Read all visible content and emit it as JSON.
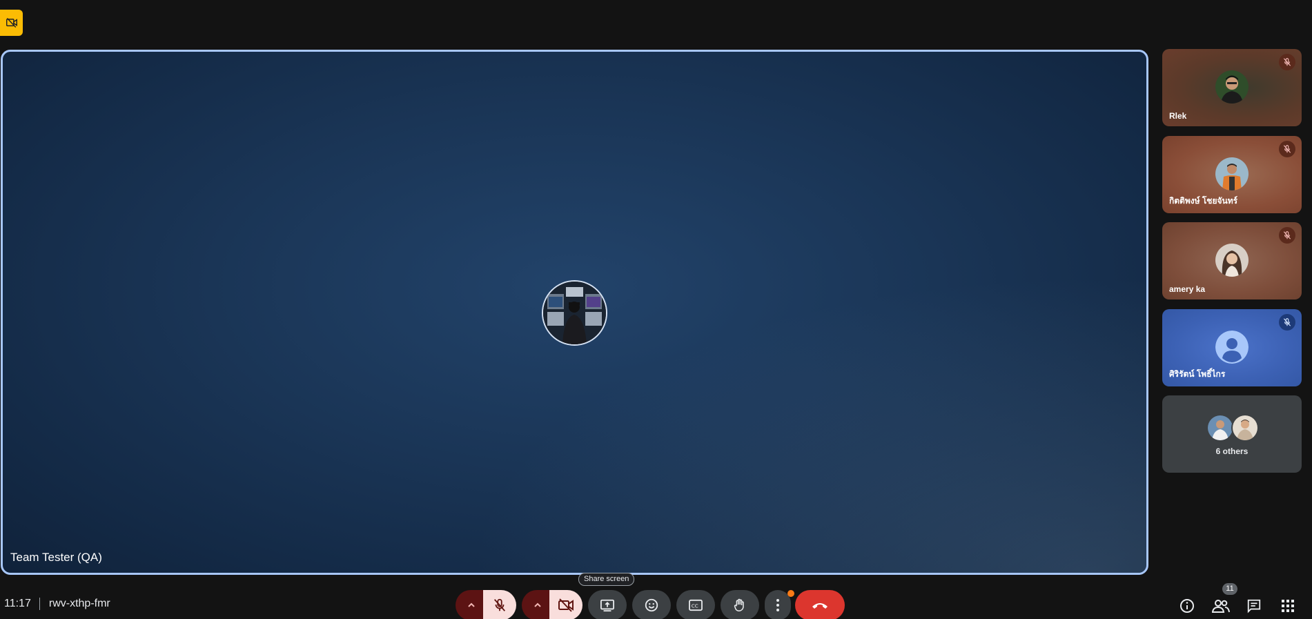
{
  "meeting": {
    "time": "11:17",
    "code": "rwv-xthp-fmr"
  },
  "main_tile": {
    "name": "Team Tester (QA)"
  },
  "participants": [
    {
      "name": "Rlek",
      "muted": true
    },
    {
      "name": "กิตติพงษ์ โชยจันทร์",
      "muted": true
    },
    {
      "name": "amery ka",
      "muted": true
    },
    {
      "name": "ศิริรัตน์ โพธิ์ไกร",
      "muted": true
    }
  ],
  "others": {
    "label": "6 others"
  },
  "controls": {
    "tooltip": "Share screen",
    "people_count": "11"
  },
  "colors": {
    "accent_border": "#a8c7fa",
    "leave": "#dc362e",
    "muted_on": "#f9dedc",
    "badge": "#fbbc04"
  },
  "icons": {
    "top_badge": "videocam-off-icon",
    "mic": "mic-off-icon",
    "cam": "videocam-off-icon",
    "present": "present-to-all-icon",
    "emoji": "emoji-icon",
    "captions": "closed-caption-icon",
    "hand": "raise-hand-icon",
    "more": "more-vert-icon",
    "leave": "call-end-icon",
    "info": "info-icon",
    "people": "people-icon",
    "chat": "chat-icon",
    "activities": "apps-icon"
  }
}
